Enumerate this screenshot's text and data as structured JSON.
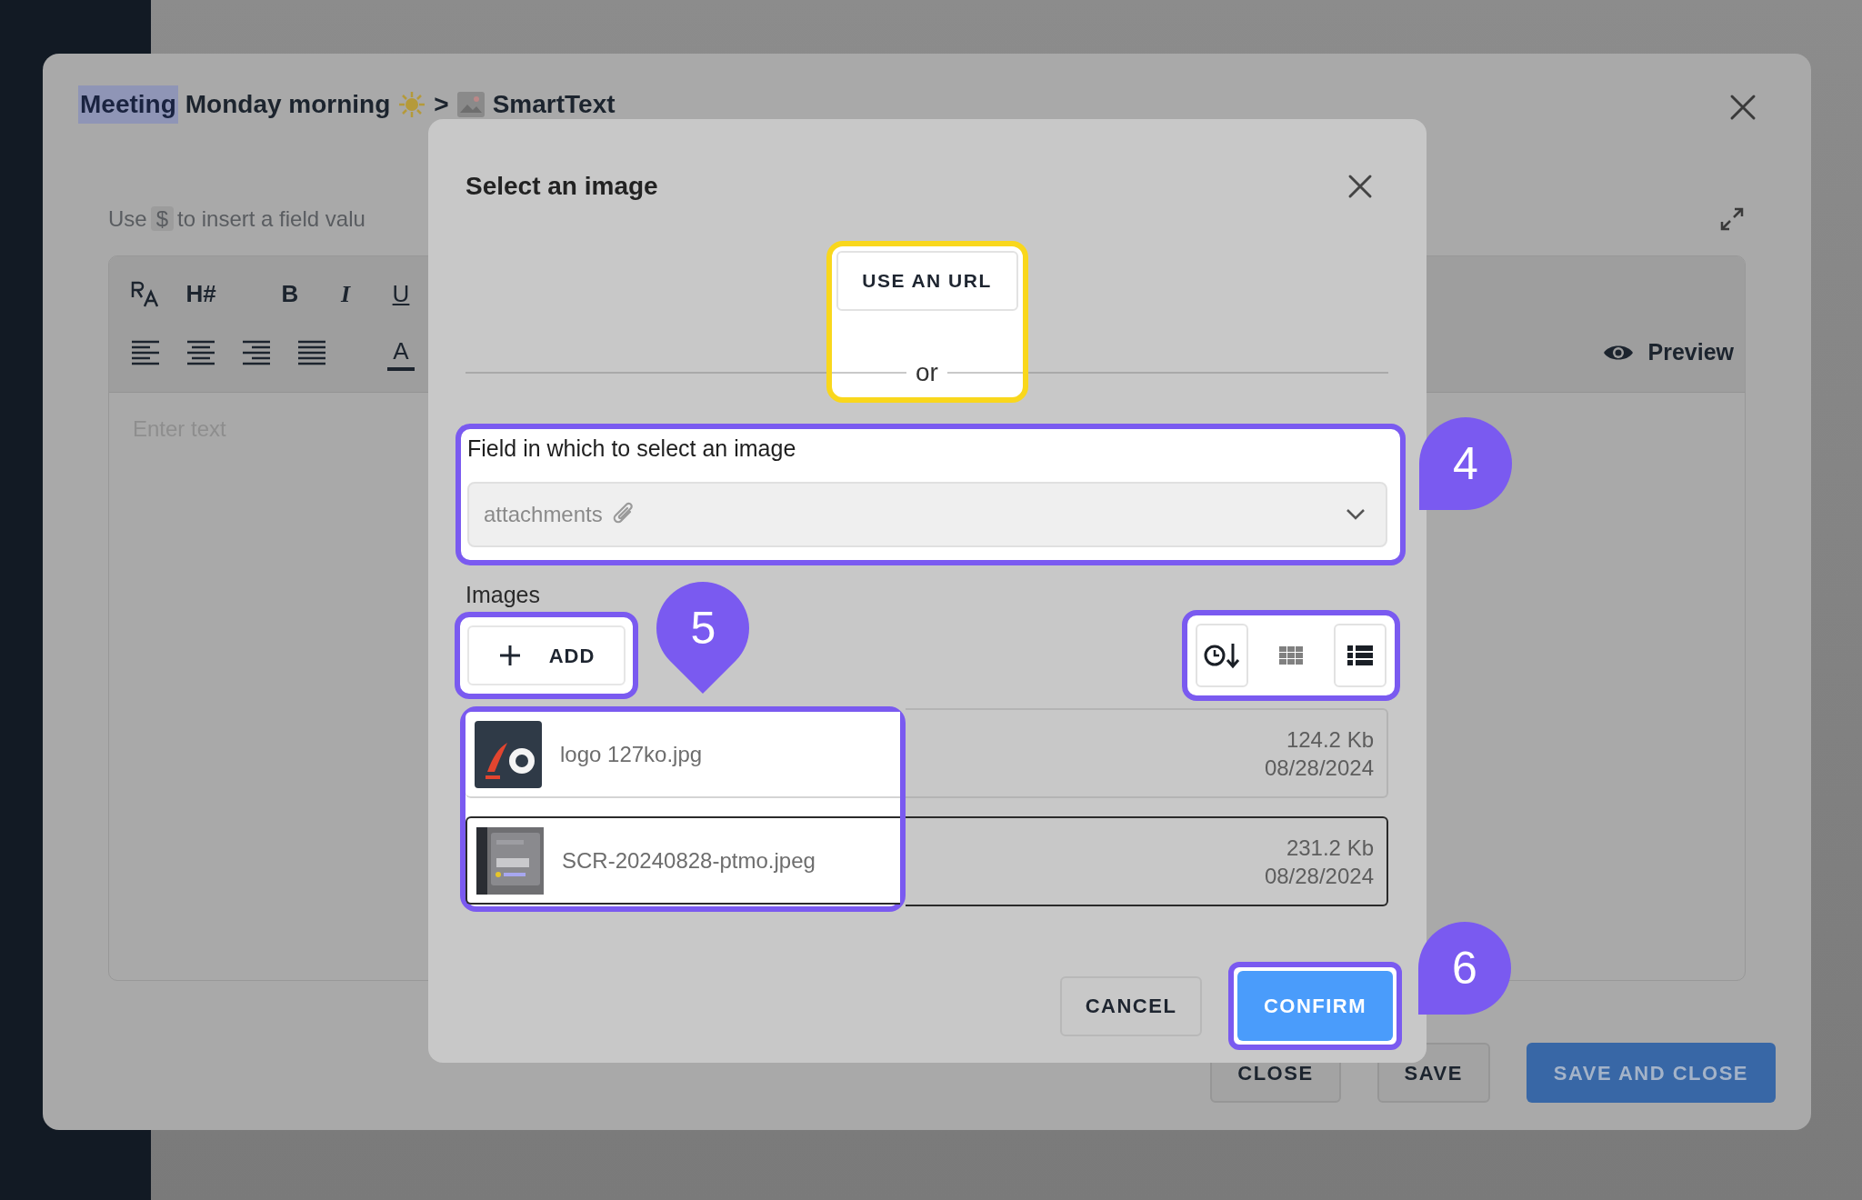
{
  "editor_window": {
    "title": {
      "highlight": "Meeting",
      "text": "Monday morning",
      "separator": ">",
      "target": "SmartText"
    },
    "hint": {
      "before": "Use",
      "code": "$",
      "after": "to insert a field valu"
    },
    "toolbar": [
      [
        [
          {
            "kind": "font-size"
          },
          {
            "kind": "text",
            "label": "H#"
          }
        ],
        [
          {
            "kind": "bold",
            "label": "B"
          },
          {
            "kind": "italic",
            "label": "I"
          },
          {
            "kind": "underline",
            "label": "U"
          }
        ]
      ],
      [
        [
          {
            "kind": "align-left"
          },
          {
            "kind": "align-center"
          },
          {
            "kind": "align-right"
          },
          {
            "kind": "justify"
          }
        ],
        [
          {
            "kind": "text-color",
            "label": "A"
          }
        ]
      ]
    ],
    "preview": "Preview",
    "placeholder": "Enter text",
    "buttons": [
      {
        "label": "CLOSE",
        "kind": "secondary"
      },
      {
        "label": "SAVE",
        "kind": "secondary"
      },
      {
        "label": "SAVE AND CLOSE",
        "kind": "primary"
      }
    ]
  },
  "image_dialog": {
    "title": "Select an image",
    "url_button": "USE AN URL",
    "separator": "or",
    "field": {
      "label": "Field in which to select an image",
      "value": "attachments"
    },
    "images_label": "Images",
    "add_button": "ADD",
    "view_buttons": [
      {
        "kind": "sort-date",
        "selected": true
      },
      {
        "kind": "grid",
        "selected": false
      },
      {
        "kind": "list",
        "selected": true
      }
    ],
    "files": [
      {
        "name": "logo 127ko.jpg",
        "size": "124.2 Kb",
        "date": "08/28/2024",
        "selected": false
      },
      {
        "name": "SCR-20240828-ptmo.jpeg",
        "size": "231.2 Kb",
        "date": "08/28/2024",
        "selected": true
      }
    ],
    "buttons": [
      {
        "label": "CANCEL",
        "kind": "secondary"
      },
      {
        "label": "CONFIRM",
        "kind": "primary"
      }
    ]
  },
  "callouts": [
    {
      "number": "4",
      "kind": "left"
    },
    {
      "number": "5",
      "kind": "down"
    },
    {
      "number": "6",
      "kind": "left"
    }
  ]
}
